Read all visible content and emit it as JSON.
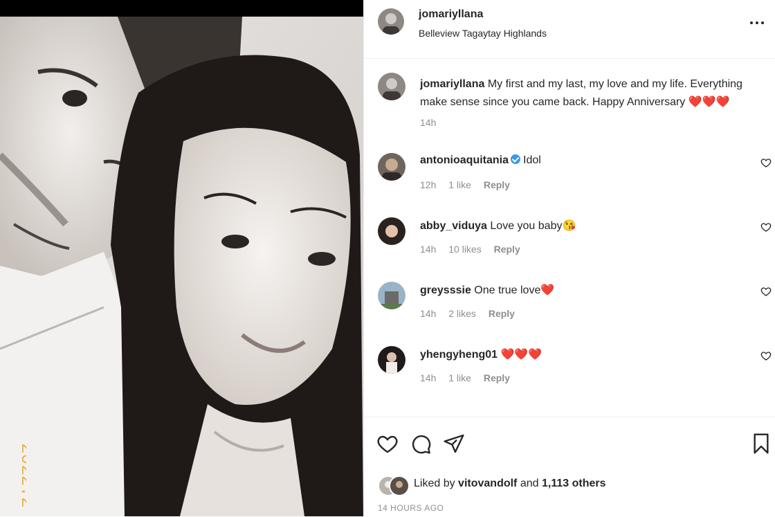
{
  "post": {
    "username": "jomariyllana",
    "location": "Belleview Tagaytay Highlands",
    "photo_date_stamp": "2022.2"
  },
  "caption": {
    "username": "jomariyllana",
    "text": "My first and my last, my love and my life. Everything make sense since you came back. Happy Anniversary ❤️❤️❤️",
    "time": "14h"
  },
  "comments": [
    {
      "username": "antonioaquitania",
      "verified": true,
      "text": "Idol",
      "time": "12h",
      "likes": "1 like",
      "reply": "Reply"
    },
    {
      "username": "abby_viduya",
      "verified": false,
      "text": "Love you baby😘",
      "time": "14h",
      "likes": "10 likes",
      "reply": "Reply"
    },
    {
      "username": "greysssie",
      "verified": false,
      "text": "One true love❤️",
      "time": "14h",
      "likes": "2 likes",
      "reply": "Reply"
    },
    {
      "username": "yhengyheng01",
      "verified": false,
      "text": "❤️❤️❤️",
      "time": "14h",
      "likes": "1 like",
      "reply": "Reply"
    }
  ],
  "actions": {
    "icons": [
      "heart-icon",
      "comment-icon",
      "share-icon",
      "bookmark-icon"
    ]
  },
  "likes": {
    "prefix": "Liked by",
    "first_user": "vitovandolf",
    "connector": "and",
    "others": "1,113 others"
  },
  "timestamp": "14 HOURS AGO",
  "colors": {
    "verified": "#3897f0",
    "heart": "#d81b1b",
    "muted_text": "#8e8e8e",
    "primary_text": "#262626"
  }
}
